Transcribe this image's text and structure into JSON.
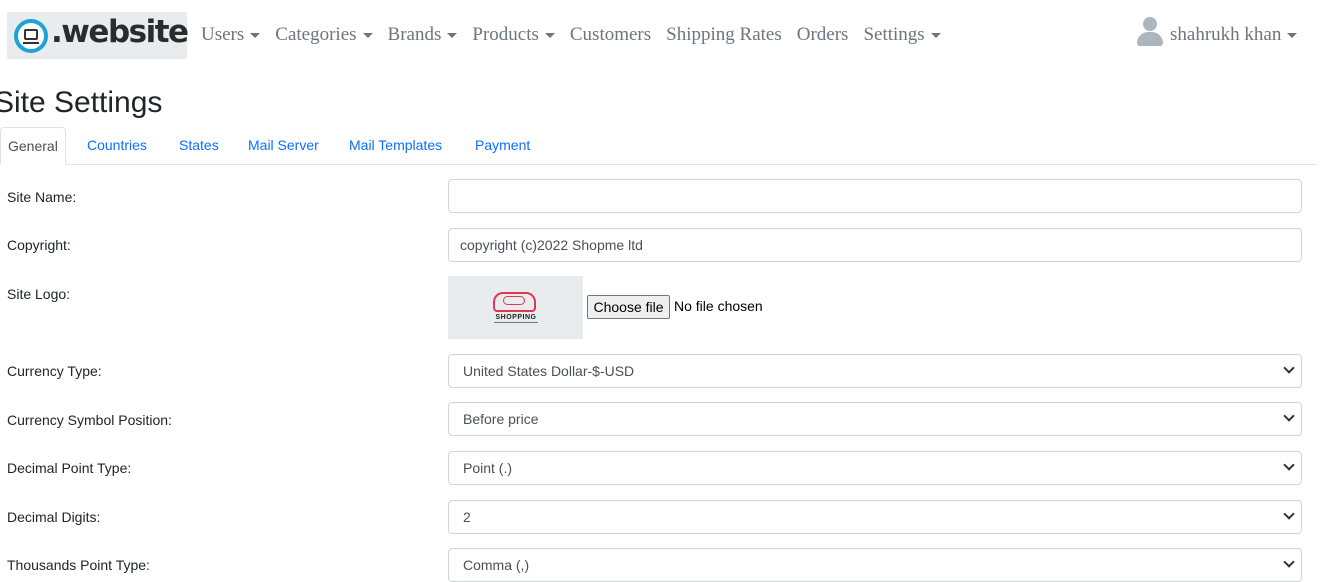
{
  "brand": {
    "logo_text": ".website"
  },
  "nav": {
    "items": [
      {
        "label": "Users",
        "dropdown": true
      },
      {
        "label": "Categories",
        "dropdown": true
      },
      {
        "label": "Brands",
        "dropdown": true
      },
      {
        "label": "Products",
        "dropdown": true
      },
      {
        "label": "Customers",
        "dropdown": false
      },
      {
        "label": "Shipping Rates",
        "dropdown": false
      },
      {
        "label": "Orders",
        "dropdown": false
      },
      {
        "label": "Settings",
        "dropdown": true
      }
    ],
    "user": {
      "name": "shahrukh khan",
      "icon": "user-icon"
    }
  },
  "page": {
    "title": "Site Settings"
  },
  "tabs": [
    {
      "label": "General",
      "active": true
    },
    {
      "label": "Countries",
      "active": false
    },
    {
      "label": "States",
      "active": false
    },
    {
      "label": "Mail Server",
      "active": false
    },
    {
      "label": "Mail Templates",
      "active": false
    },
    {
      "label": "Payment",
      "active": false
    }
  ],
  "form": {
    "site_name": {
      "label": "Site Name:",
      "value": ""
    },
    "copyright": {
      "label": "Copyright:",
      "value": "copyright (c)2022 Shopme ltd"
    },
    "site_logo": {
      "label": "Site Logo:",
      "preview_text": "SHOPPING",
      "button_label": "Choose file",
      "status": "No file chosen"
    },
    "currency_type": {
      "label": "Currency Type:",
      "selected": "United States Dollar-$-USD"
    },
    "currency_symbol_position": {
      "label": "Currency Symbol Position:",
      "selected": "Before price"
    },
    "decimal_point_type": {
      "label": "Decimal Point Type:",
      "selected": "Point (.)"
    },
    "decimal_digits": {
      "label": "Decimal Digits:",
      "selected": "2"
    },
    "thousands_point_type": {
      "label": "Thousands Point Type:",
      "selected": "Comma (,)"
    }
  },
  "colors": {
    "link": "#0d6efd",
    "nav_text": "#6c757d",
    "logo_accent": "#1fa2d6",
    "logo_pink": "#e0394f"
  }
}
